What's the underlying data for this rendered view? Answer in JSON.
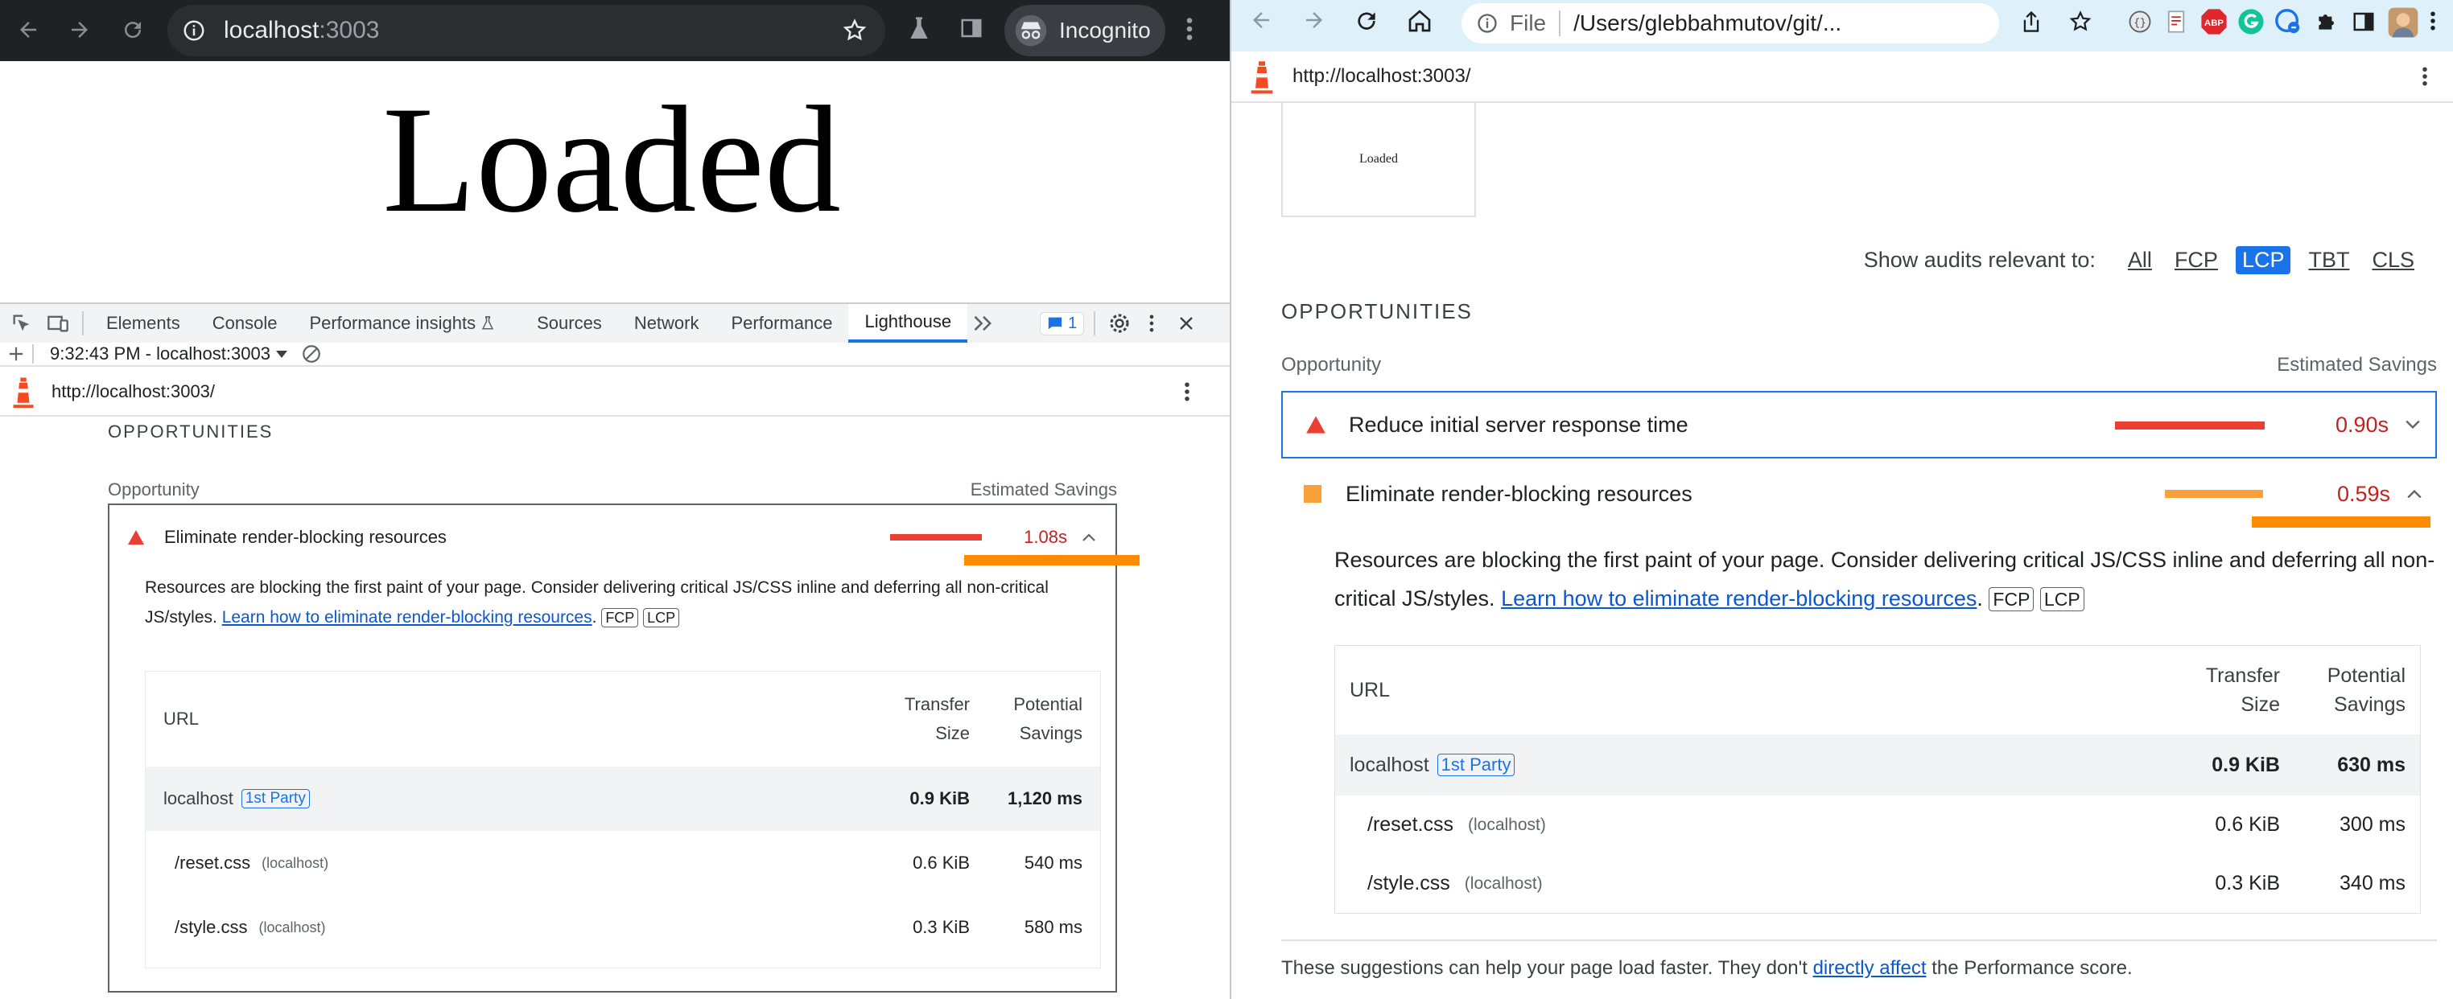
{
  "left": {
    "browser": {
      "url_host": "localhost",
      "url_port": ":3003",
      "incognito_label": "Incognito"
    },
    "page": {
      "heading": "Loaded"
    },
    "devtools": {
      "tabs": [
        "Elements",
        "Console",
        "Performance insights",
        "Sources",
        "Network",
        "Performance",
        "Lighthouse"
      ],
      "active_tab": "Lighthouse",
      "issues_count": "1",
      "report_selector": "9:32:43 PM - localhost:3003",
      "report_url": "http://localhost:3003/"
    },
    "report": {
      "section_title": "OPPORTUNITIES",
      "col_opportunity": "Opportunity",
      "col_savings": "Estimated Savings",
      "audit": {
        "title": "Eliminate render-blocking resources",
        "savings": "1.08s",
        "bar_fraction": 0.55,
        "description": "Resources are blocking the first paint of your page. Consider delivering critical JS/CSS inline and deferring all non-critical JS/styles.",
        "link_text": "Learn how to eliminate render-blocking resources",
        "after_link": ".",
        "tags": [
          "FCP",
          "LCP"
        ],
        "table": {
          "col_url": "URL",
          "col_transfer_1": "Transfer",
          "col_transfer_2": "Size",
          "col_potential_1": "Potential",
          "col_potential_2": "Savings",
          "group": {
            "host": "localhost",
            "party": "1st Party",
            "size": "0.9 KiB",
            "savings": "1,120 ms"
          },
          "rows": [
            {
              "path": "/reset.css",
              "origin": "(localhost)",
              "size": "0.6 KiB",
              "savings": "540 ms"
            },
            {
              "path": "/style.css",
              "origin": "(localhost)",
              "size": "0.3 KiB",
              "savings": "580 ms"
            }
          ]
        }
      }
    }
  },
  "right": {
    "browser": {
      "file_label": "File",
      "path": "/Users/glebbahmutov/git/...",
      "ext_abp": "ABP"
    },
    "report": {
      "report_url": "http://localhost:3003/",
      "thumb_text": "Loaded",
      "filter_label": "Show audits relevant to:",
      "filters": [
        "All",
        "FCP",
        "LCP",
        "TBT",
        "CLS"
      ],
      "active_filter": "LCP",
      "section_title": "OPPORTUNITIES",
      "col_opportunity": "Opportunity",
      "col_savings": "Estimated Savings",
      "audits": [
        {
          "title": "Reduce initial server response time",
          "savings": "0.90s",
          "bar_fraction": 0.95,
          "status": "fail",
          "color": "#eb3f34"
        },
        {
          "title": "Eliminate render-blocking resources",
          "savings": "0.59s",
          "bar_fraction": 0.62,
          "status": "average",
          "color": "#f8a13a"
        }
      ],
      "description": "Resources are blocking the first paint of your page. Consider delivering critical JS/CSS inline and deferring all non-critical JS/styles.",
      "link_text": "Learn how to eliminate render-blocking resources",
      "after_link": ".",
      "tags": [
        "FCP",
        "LCP"
      ],
      "table": {
        "col_url": "URL",
        "col_transfer_1": "Transfer",
        "col_transfer_2": "Size",
        "col_potential_1": "Potential",
        "col_potential_2": "Savings",
        "group": {
          "host": "localhost",
          "party": "1st Party",
          "size": "0.9 KiB",
          "savings": "630 ms"
        },
        "rows": [
          {
            "path": "/reset.css",
            "origin": "(localhost)",
            "size": "0.6 KiB",
            "savings": "300 ms"
          },
          {
            "path": "/style.css",
            "origin": "(localhost)",
            "size": "0.3 KiB",
            "savings": "340 ms"
          }
        ]
      },
      "footer_before": "These suggestions can help your page load faster. They don't",
      "footer_link": "directly affect",
      "footer_after": "the Performance score."
    }
  },
  "colors": {
    "fail": "#eb3f34",
    "average": "#f8a13a",
    "highlight": "#ff8c00",
    "accent": "#1a73e8"
  }
}
